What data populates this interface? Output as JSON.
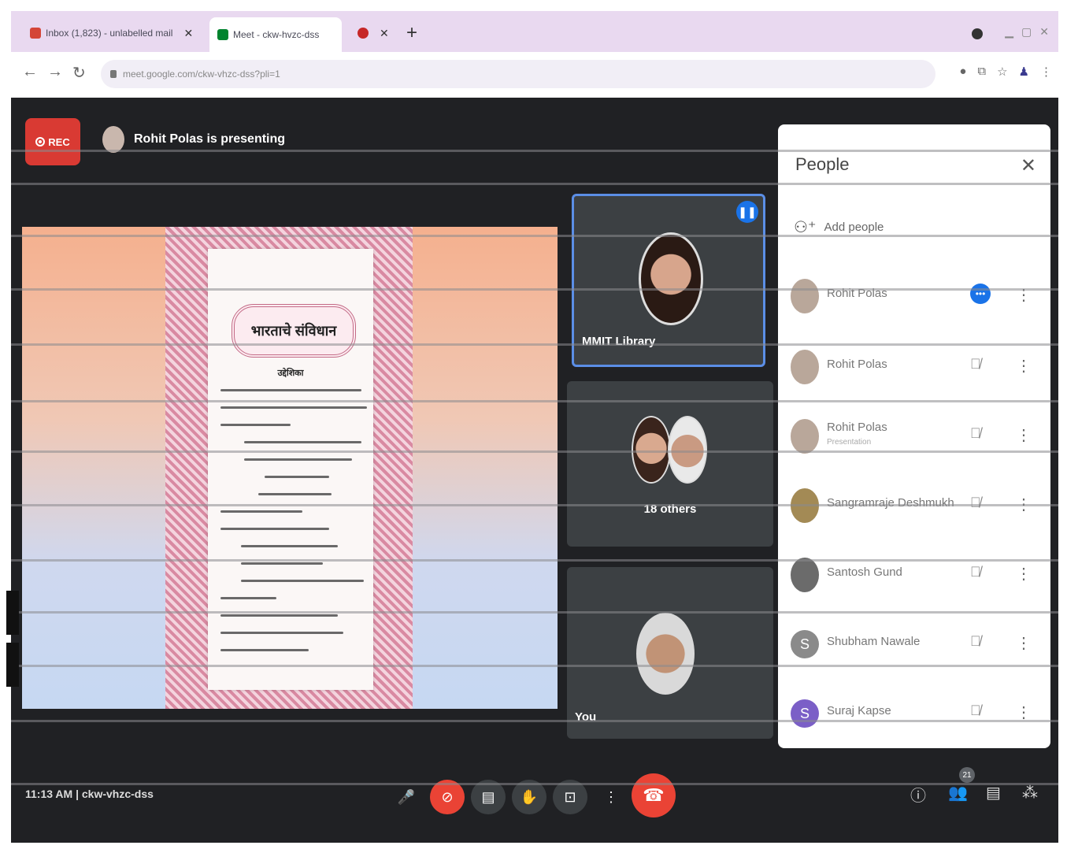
{
  "browser": {
    "tabs": [
      {
        "label": "Inbox (1,823) - unlabelled mail",
        "favicon_color": "#d44638"
      },
      {
        "label": "Meet - ckw-hvzc-dss",
        "favicon_color": "#00832d"
      },
      {
        "label": "",
        "favicon_color": "#c62828"
      }
    ],
    "new_tab_label": "+",
    "url": "meet.google.com/ckw-vhzc-dss?pli=1"
  },
  "meet": {
    "rec_label": "REC",
    "presenting_text": "Rohit Polas is presenting",
    "document": {
      "title": "भारताचे संविधान",
      "subtitle": "उद्देशिका"
    },
    "tiles": [
      {
        "name": "MMIT Library"
      },
      {
        "name": "18 others"
      },
      {
        "name": "You"
      }
    ],
    "people_panel": {
      "title": "People",
      "add_people": "Add people",
      "participants": [
        {
          "name": "Rohit Polas",
          "sub": "",
          "state": "speaking",
          "avatar_initial": ""
        },
        {
          "name": "Rohit Polas",
          "sub": "",
          "state": "muted",
          "avatar_initial": ""
        },
        {
          "name": "Rohit Polas",
          "sub": "Presentation",
          "state": "muted",
          "avatar_initial": ""
        },
        {
          "name": "Sangramraje Deshmukh",
          "sub": "",
          "state": "muted",
          "avatar_initial": ""
        },
        {
          "name": "Santosh Gund",
          "sub": "",
          "state": "muted",
          "avatar_initial": ""
        },
        {
          "name": "Shubham Nawale",
          "sub": "",
          "state": "muted",
          "avatar_initial": "S"
        },
        {
          "name": "Suraj Kapse",
          "sub": "",
          "state": "muted",
          "avatar_initial": "S"
        }
      ]
    },
    "bottom_bar": {
      "meeting_info": "11:13 AM  |  ckw-vhzc-dss",
      "participant_count": "21"
    }
  },
  "colors": {
    "meet_bg": "#202124",
    "accent": "#1a73e8",
    "danger": "#ea4335"
  }
}
